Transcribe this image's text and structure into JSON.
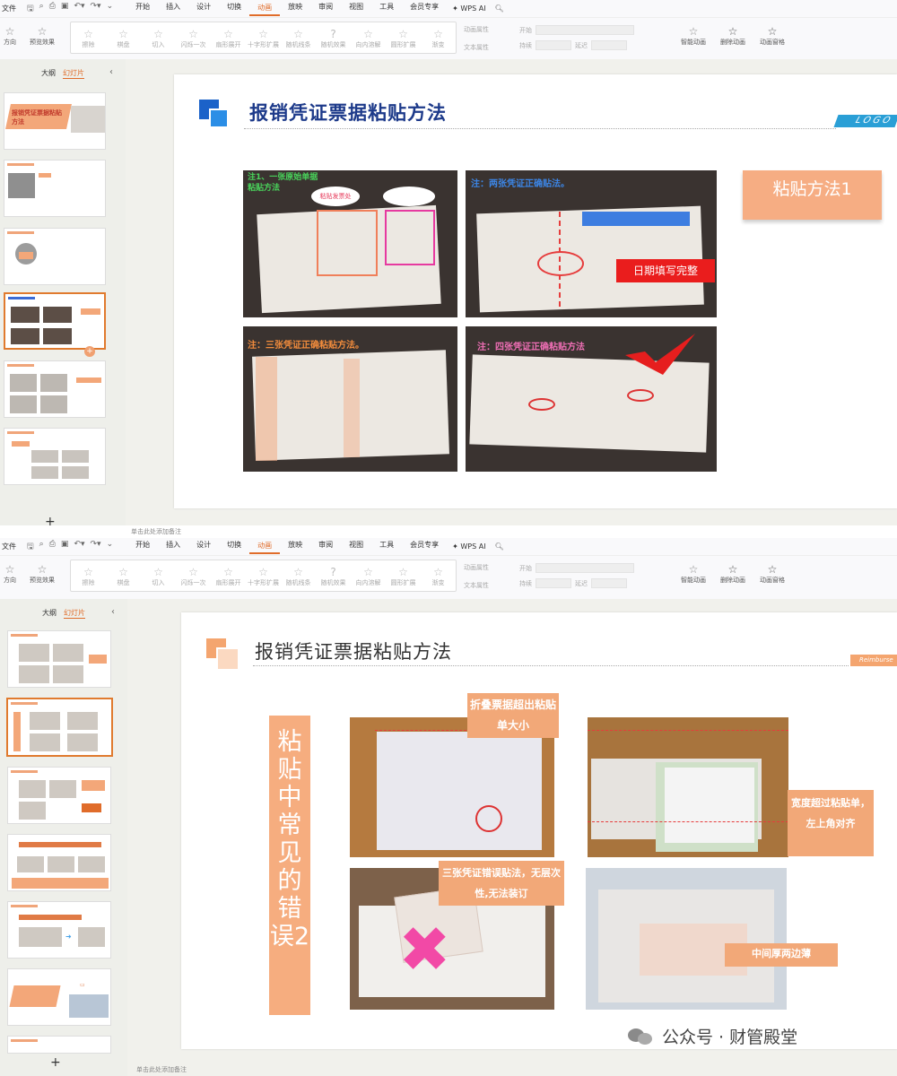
{
  "window1": {
    "menubar": {
      "file": "文件",
      "menus": [
        "开始",
        "插入",
        "设计",
        "切换",
        "动画",
        "放映",
        "审阅",
        "视图",
        "工具",
        "会员专享"
      ],
      "active_menu": "动画",
      "wps_ai": "WPS AI"
    },
    "toolbar": {
      "left_tool": "方向",
      "preview_effects": "预览效果",
      "effects": [
        "擦除",
        "棋盘",
        "切入",
        "闪烁一次",
        "扇形展开",
        "十字形扩展",
        "随机线条",
        "随机效果",
        "向内溶解",
        "圆形扩展",
        "渐变"
      ],
      "anim_props": "动画属性",
      "text_props": "文本属性",
      "start_label": "开始",
      "duration_label": "持续",
      "delay_label": "延迟",
      "smart_anim": "智能动画",
      "delete_anim": "删除动画",
      "anim_pane": "动画窗格"
    },
    "panel": {
      "tab_outline": "大纲",
      "tab_slides": "幻灯片"
    },
    "thumbs": [
      {
        "num": "",
        "title": "报销凭证票据粘贴方法"
      },
      {
        "num": ""
      },
      {
        "num": ""
      },
      {
        "num": ""
      },
      {
        "num": ""
      },
      {
        "num": ""
      }
    ],
    "add_slide": "+",
    "notes": "单击此处添加备注",
    "slide": {
      "title": "报销凭证票据粘贴方法",
      "logo": "LOGO",
      "method_label": "粘贴方法1",
      "captions": {
        "c1": "注1、一张原始单据粘贴方法",
        "c2": "注：两张凭证正确贴法。",
        "c3": "注：三张凭证正确粘贴方法。",
        "c4": "注：四张凭证正确粘贴方法",
        "paste_here": "粘贴发票处",
        "date_fill": "日期填写完整"
      }
    }
  },
  "window2": {
    "menubar": {
      "file": "文件",
      "menus": [
        "开始",
        "插入",
        "设计",
        "切换",
        "动画",
        "放映",
        "审阅",
        "视图",
        "工具",
        "会员专享"
      ],
      "active_menu": "动画",
      "wps_ai": "WPS AI"
    },
    "toolbar": {
      "left_tool": "方向",
      "preview_effects": "预览效果",
      "effects": [
        "擦除",
        "棋盘",
        "切入",
        "闪烁一次",
        "扇形展开",
        "十字形扩展",
        "随机线条",
        "随机效果",
        "向内溶解",
        "圆形扩展",
        "渐变"
      ],
      "anim_props": "动画属性",
      "text_props": "文本属性",
      "start_label": "开始",
      "duration_label": "持续",
      "delay_label": "延迟",
      "smart_anim": "智能动画",
      "delete_anim": "删除动画",
      "anim_pane": "动画窗格"
    },
    "panel": {
      "tab_outline": "大纲",
      "tab_slides": "幻灯片"
    },
    "add_slide": "+",
    "notes": "单击此处添加备注",
    "slide": {
      "title": "报销凭证票据粘贴方法",
      "tag": "Reimburse",
      "vertical_label": "粘贴中常见的错误2",
      "callouts": {
        "fold": "折叠票据超出粘贴单大小",
        "width": "宽度超过粘贴单，左上角对齐",
        "three": "三张凭证错误贴法，无层次性,无法装订",
        "thick": "中间厚两边薄"
      }
    }
  },
  "watermark": {
    "text": "公众号 · 财管殿堂"
  },
  "colors": {
    "accent": "#e06c2a",
    "title_blue": "#1d3a8a",
    "orange_box": "#f6ad83",
    "red_box": "#ea1d1d",
    "pink_x": "#f249a6"
  }
}
